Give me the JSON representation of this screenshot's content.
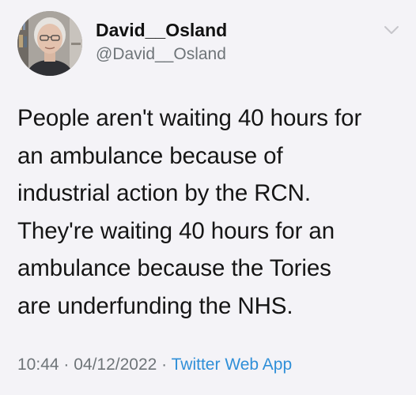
{
  "tweet": {
    "display_name": "David__Osland",
    "handle": "@David__Osland",
    "text": "People aren't waiting 40 hours for\nan ambulance because of\nindustrial action by the RCN.\nThey're waiting 40 hours for an\nambulance because the Tories\nare underfunding the NHS.",
    "time": "10:44",
    "separator": " · ",
    "date": "04/12/2022",
    "source": "Twitter Web App"
  },
  "icons": {
    "avatar": "avatar-photo",
    "menu": "chevron-down-icon"
  },
  "colors": {
    "background": "#f4f3f7",
    "text": "#151515",
    "secondary": "#6e7478",
    "link": "#2f8fd8"
  }
}
